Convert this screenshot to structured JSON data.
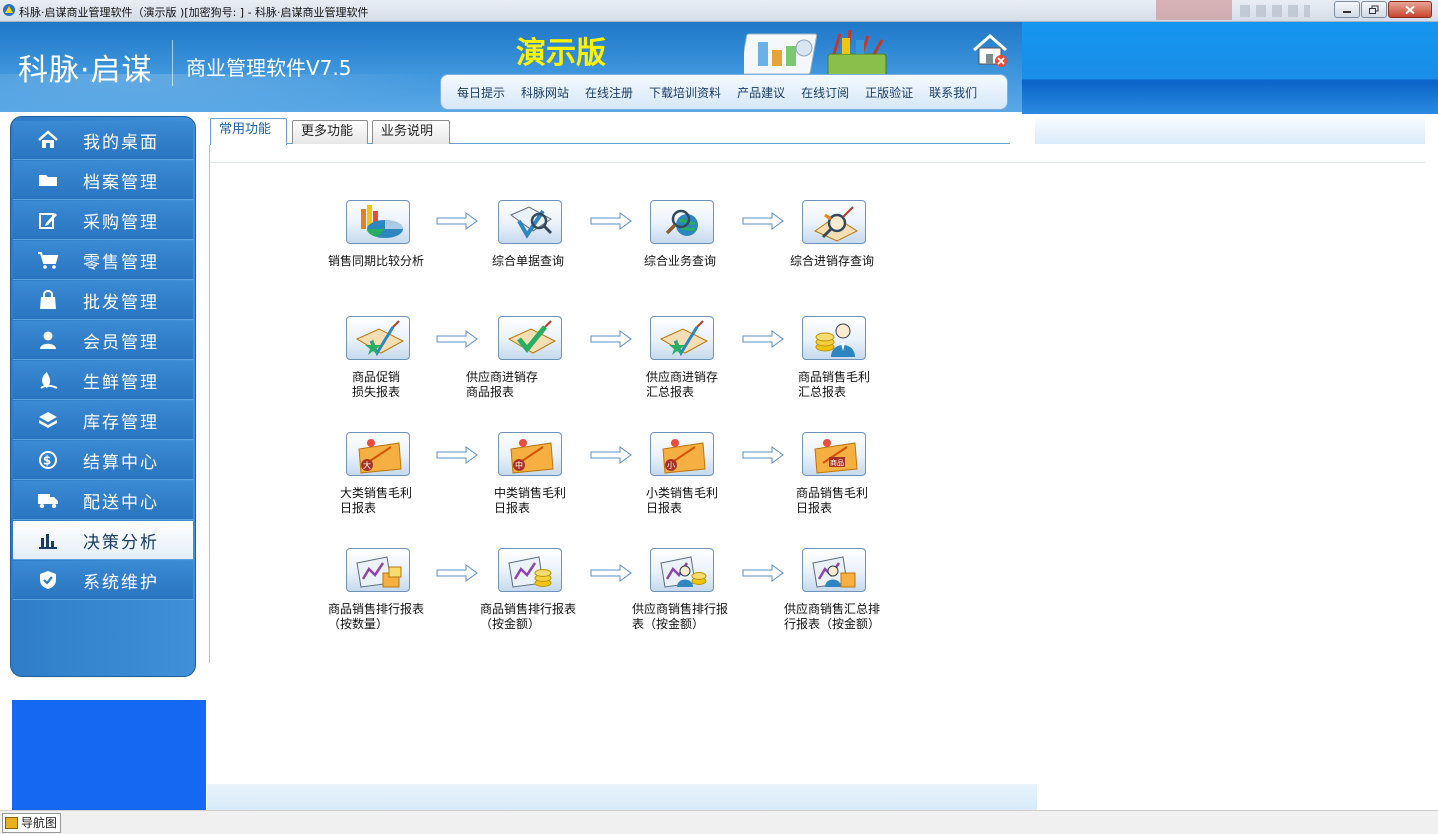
{
  "window": {
    "title": "科脉·启谋商业管理软件（演示版 )[加密狗号: ] - 科脉·启谋商业管理软件"
  },
  "header": {
    "logo_main": "科脉·启谋",
    "logo_sub": "商业管理软件V7.5",
    "demo_label": "演示版",
    "nav": [
      "每日提示",
      "科脉网站",
      "在线注册",
      "下载培训资料",
      "产品建议",
      "在线订阅",
      "正版验证",
      "联系我们"
    ]
  },
  "sidebar": {
    "items": [
      {
        "label": "我的桌面",
        "icon": "home-icon"
      },
      {
        "label": "档案管理",
        "icon": "folder-icon"
      },
      {
        "label": "采购管理",
        "icon": "edit-icon"
      },
      {
        "label": "零售管理",
        "icon": "cart-icon"
      },
      {
        "label": "批发管理",
        "icon": "bag-icon"
      },
      {
        "label": "会员管理",
        "icon": "user-icon"
      },
      {
        "label": "生鲜管理",
        "icon": "leaf-icon"
      },
      {
        "label": "库存管理",
        "icon": "box-icon"
      },
      {
        "label": "结算中心",
        "icon": "dollar-icon"
      },
      {
        "label": "配送中心",
        "icon": "truck-icon"
      },
      {
        "label": "决策分析",
        "icon": "bar-chart-icon",
        "active": true
      },
      {
        "label": "系统维护",
        "icon": "shield-icon"
      }
    ]
  },
  "tabs": [
    {
      "label": "常用功能",
      "active": true
    },
    {
      "label": "更多功能"
    },
    {
      "label": "业务说明"
    }
  ],
  "functions": [
    [
      {
        "label": "销售同期比较分析",
        "icon": "pie-chart-icon"
      },
      {
        "label": "综合单据查询",
        "icon": "search-doc-icon"
      },
      {
        "label": "综合业务查询",
        "icon": "globe-search-icon"
      },
      {
        "label": "综合进销存查询",
        "icon": "magnifier-icon"
      }
    ],
    [
      {
        "label": "商品促销\n损失报表",
        "icon": "star-report-icon"
      },
      {
        "label": "供应商进销存\n商品报表",
        "icon": "check-report-icon"
      },
      {
        "label": "供应商进销存\n汇总报表",
        "icon": "star-report-icon"
      },
      {
        "label": "商品销售毛利\n汇总报表",
        "icon": "coin-user-icon"
      }
    ],
    [
      {
        "label": "大类销售毛利\n日报表",
        "icon": "big-category-icon",
        "badge": "大"
      },
      {
        "label": "中类销售毛利\n日报表",
        "icon": "mid-category-icon",
        "badge": "中"
      },
      {
        "label": "小类销售毛利\n日报表",
        "icon": "small-category-icon",
        "badge": "小"
      },
      {
        "label": "商品销售毛利\n日报表",
        "icon": "product-report-icon",
        "badge": "商品"
      }
    ],
    [
      {
        "label": "商品销售排行报表\n（按数量）",
        "icon": "rank-chart-icon"
      },
      {
        "label": "商品销售排行报表\n（按金额）",
        "icon": "rank-money-icon"
      },
      {
        "label": "供应商销售排行报\n表（按金额）",
        "icon": "supplier-rank-icon"
      },
      {
        "label": "供应商销售汇总排\n行报表（按金额）",
        "icon": "supplier-sum-icon"
      }
    ]
  ],
  "statusbar": {
    "nav_label": "导航图"
  },
  "colors": {
    "header_blue": "#2f86d2",
    "demo_yellow": "#fff200",
    "sidebar_blue": "#3a8ad4"
  }
}
